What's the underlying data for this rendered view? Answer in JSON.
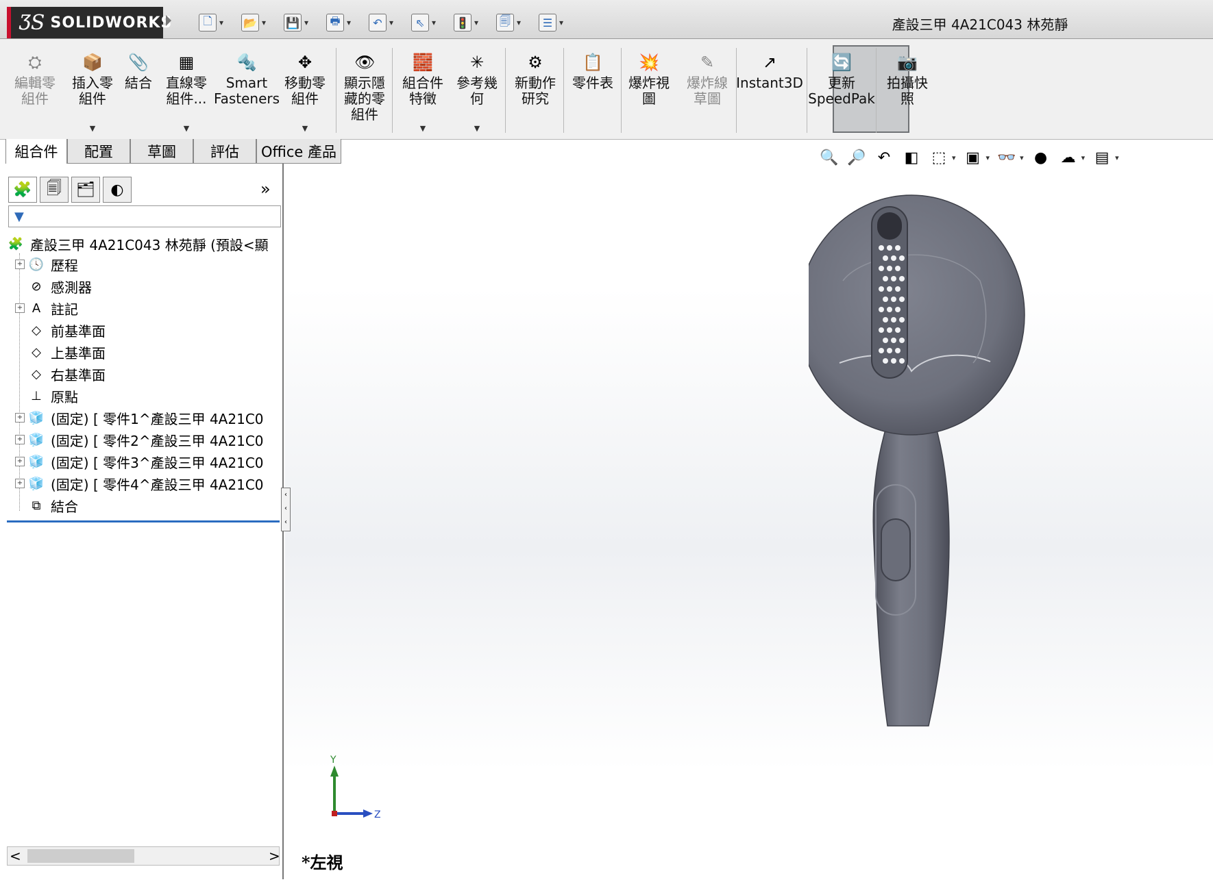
{
  "app": {
    "logo_prefix": "ƷS",
    "logo_text": "SOLIDWORKS"
  },
  "document_title": "產設三甲 4A21C043 林苑靜",
  "quick_access": [
    {
      "name": "new-document-icon",
      "glyph": "🗋"
    },
    {
      "name": "open-icon",
      "glyph": "📂"
    },
    {
      "name": "save-icon",
      "glyph": "💾"
    },
    {
      "name": "print-icon",
      "glyph": "🖶"
    },
    {
      "name": "undo-icon",
      "glyph": "↶"
    },
    {
      "name": "select-icon",
      "glyph": "⇖"
    },
    {
      "name": "rebuild-icon",
      "glyph": "🚦"
    },
    {
      "name": "file-properties-icon",
      "glyph": "🗐"
    },
    {
      "name": "options-icon",
      "glyph": "☰"
    }
  ],
  "commands": [
    {
      "label": "編輯零\n組件",
      "icon": "edit-component-icon",
      "glyph": "⛭",
      "disabled": true
    },
    {
      "label": "插入零\n組件",
      "icon": "insert-components-icon",
      "glyph": "📦",
      "disabled": false,
      "dropdown": true
    },
    {
      "label": "結合",
      "icon": "mate-icon",
      "glyph": "📎",
      "disabled": false
    },
    {
      "label": "直線零\n組件...",
      "icon": "linear-pattern-icon",
      "glyph": "▦",
      "disabled": false,
      "dropdown": true
    },
    {
      "label": "Smart\nFasteners",
      "icon": "smart-fasteners-icon",
      "glyph": "🔩",
      "disabled": false
    },
    {
      "label": "移動零\n組件",
      "icon": "move-component-icon",
      "glyph": "✥",
      "disabled": false,
      "dropdown": true
    },
    {
      "label": "顯示隱\n藏的零\n組件",
      "icon": "show-hidden-icon",
      "glyph": "👁",
      "disabled": false
    },
    {
      "label": "組合件\n特徵",
      "icon": "assembly-features-icon",
      "glyph": "🧱",
      "disabled": false,
      "dropdown": true
    },
    {
      "label": "參考幾\n何",
      "icon": "reference-geometry-icon",
      "glyph": "✳",
      "disabled": false,
      "dropdown": true
    },
    {
      "label": "新動作\n研究",
      "icon": "new-motion-study-icon",
      "glyph": "⚙",
      "disabled": false
    },
    {
      "label": "零件表",
      "icon": "bill-of-materials-icon",
      "glyph": "📋",
      "disabled": false
    },
    {
      "label": "爆炸視\n圖",
      "icon": "exploded-view-icon",
      "glyph": "💥",
      "disabled": false
    },
    {
      "label": "爆炸線\n草圖",
      "icon": "explode-line-sketch-icon",
      "glyph": "✎",
      "disabled": true
    },
    {
      "label": "Instant3D",
      "icon": "instant3d-icon",
      "glyph": "↗",
      "disabled": false,
      "active": true
    },
    {
      "label": "更新\nSpeedPak",
      "icon": "update-speedpak-icon",
      "glyph": "🔄",
      "disabled": false
    },
    {
      "label": "拍攝快\n照",
      "icon": "take-snapshot-icon",
      "glyph": "📷",
      "disabled": false
    }
  ],
  "tabs": [
    "組合件",
    "配置",
    "草圖",
    "評估",
    "Office 產品"
  ],
  "active_tab": "組合件",
  "panel_tabs": [
    {
      "name": "feature-manager-tab-icon",
      "glyph": "🧩"
    },
    {
      "name": "property-manager-tab-icon",
      "glyph": "🗐"
    },
    {
      "name": "configuration-manager-tab-icon",
      "glyph": "🗂"
    },
    {
      "name": "display-manager-tab-icon",
      "glyph": "◐"
    }
  ],
  "panel_more": "»",
  "filter_icon": "▼",
  "tree": {
    "root": "產設三甲 4A21C043 林苑靜 (預設<顯",
    "items": [
      {
        "label": "歷程",
        "icon": "history-icon",
        "glyph": "🕓",
        "expandable": true
      },
      {
        "label": "感測器",
        "icon": "sensors-icon",
        "glyph": "⊘",
        "expandable": false
      },
      {
        "label": "註記",
        "icon": "annotations-icon",
        "glyph": "A",
        "expandable": true
      },
      {
        "label": "前基準面",
        "icon": "plane-icon",
        "glyph": "◇",
        "expandable": false
      },
      {
        "label": "上基準面",
        "icon": "plane-icon",
        "glyph": "◇",
        "expandable": false
      },
      {
        "label": "右基準面",
        "icon": "plane-icon",
        "glyph": "◇",
        "expandable": false
      },
      {
        "label": "原點",
        "icon": "origin-icon",
        "glyph": "⊥",
        "expandable": false
      },
      {
        "label": "(固定) [ 零件1^產設三甲 4A21C0",
        "icon": "part-icon",
        "glyph": "🧊",
        "expandable": true
      },
      {
        "label": "(固定) [ 零件2^產設三甲 4A21C0",
        "icon": "part-icon",
        "glyph": "🧊",
        "expandable": true
      },
      {
        "label": "(固定) [ 零件3^產設三甲 4A21C0",
        "icon": "part-icon",
        "glyph": "🧊",
        "expandable": true
      },
      {
        "label": "(固定) [ 零件4^產設三甲 4A21C0",
        "icon": "part-icon",
        "glyph": "🧊",
        "expandable": true
      },
      {
        "label": "結合",
        "icon": "mates-folder-icon",
        "glyph": "⧉",
        "expandable": false
      }
    ]
  },
  "heads_up": [
    {
      "name": "zoom-to-fit-icon",
      "glyph": "🔍",
      "dropdown": false
    },
    {
      "name": "zoom-to-area-icon",
      "glyph": "🔎",
      "dropdown": false
    },
    {
      "name": "previous-view-icon",
      "glyph": "↶",
      "dropdown": false
    },
    {
      "name": "section-view-icon",
      "glyph": "◧",
      "dropdown": false
    },
    {
      "name": "view-orientation-icon",
      "glyph": "⬚",
      "dropdown": true
    },
    {
      "name": "display-style-icon",
      "glyph": "▣",
      "dropdown": true
    },
    {
      "name": "hide-show-items-icon",
      "glyph": "👓",
      "dropdown": true
    },
    {
      "name": "edit-appearance-icon",
      "glyph": "●",
      "dropdown": false
    },
    {
      "name": "apply-scene-icon",
      "glyph": "☁",
      "dropdown": true
    },
    {
      "name": "view-settings-icon",
      "glyph": "▤",
      "dropdown": true
    }
  ],
  "triad": {
    "y": "Y",
    "z": "Z"
  },
  "view_name": "*左視",
  "scroll": {
    "left": "<",
    "right": ">"
  },
  "colors": {
    "model": "#6c6f7e",
    "model_dark": "#4a4c58",
    "accent_blue": "#2a6cc0"
  }
}
